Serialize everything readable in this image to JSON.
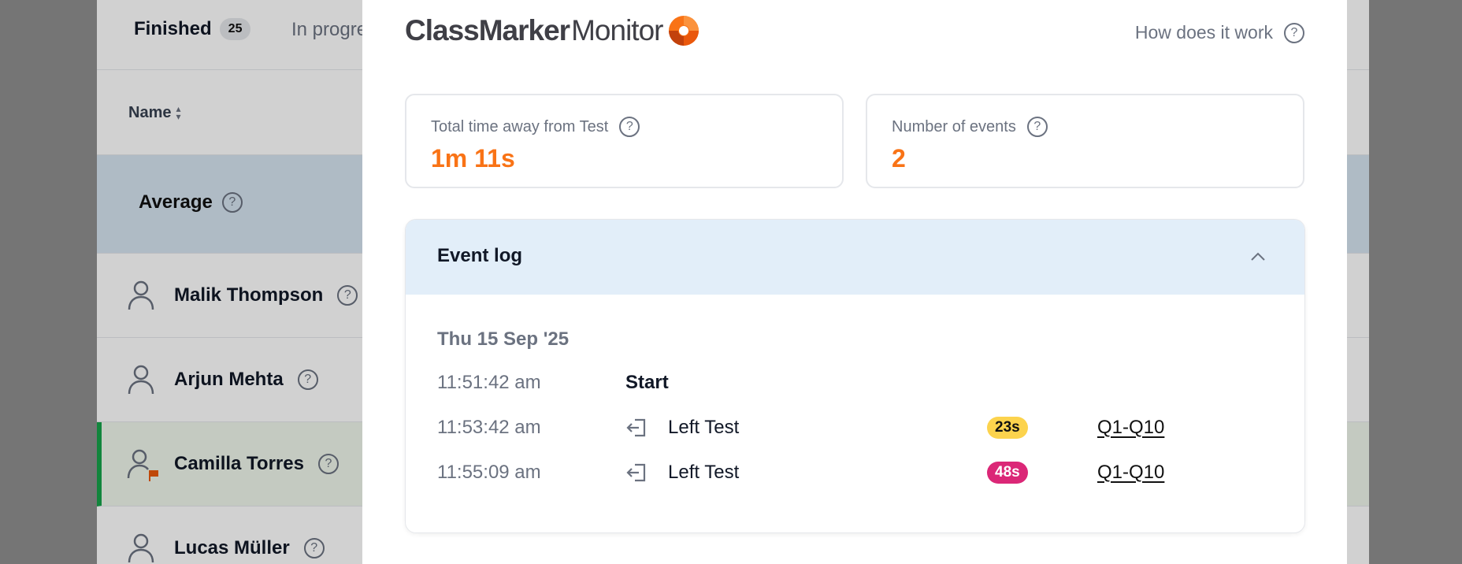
{
  "background": {
    "tabs": {
      "finished_label": "Finished",
      "finished_count": "25",
      "in_progress_label": "In progress"
    },
    "table": {
      "name_header": "Name",
      "average_label": "Average",
      "people": [
        {
          "name": "Malik Thompson",
          "flagged": false,
          "selected": false
        },
        {
          "name": "Arjun Mehta",
          "flagged": false,
          "selected": false
        },
        {
          "name": "Camilla Torres",
          "flagged": true,
          "selected": true
        },
        {
          "name": "Lucas Müller",
          "flagged": false,
          "selected": false
        }
      ]
    }
  },
  "modal": {
    "logo": {
      "part1": "ClassMarker",
      "part2": "Monitor"
    },
    "help_link": "How does it work",
    "stats": [
      {
        "label": "Total time away from Test",
        "value": "1m 11s"
      },
      {
        "label": "Number of events",
        "value": "2"
      }
    ],
    "event_log": {
      "title": "Event log",
      "date": "Thu 15 Sep '25",
      "events": [
        {
          "time": "11:51:42 am",
          "name": "Start",
          "icon": null,
          "duration": null,
          "questions": null
        },
        {
          "time": "11:53:42 am",
          "name": "Left Test",
          "icon": "exit-icon",
          "duration": "23s",
          "badge_color": "#fcd34d",
          "questions": "Q1-Q10"
        },
        {
          "time": "11:55:09 am",
          "name": "Left Test",
          "icon": "exit-icon",
          "duration": "48s",
          "badge_color": "#db2777",
          "questions": "Q1-Q10"
        }
      ]
    },
    "accent_color": "#f97316"
  }
}
